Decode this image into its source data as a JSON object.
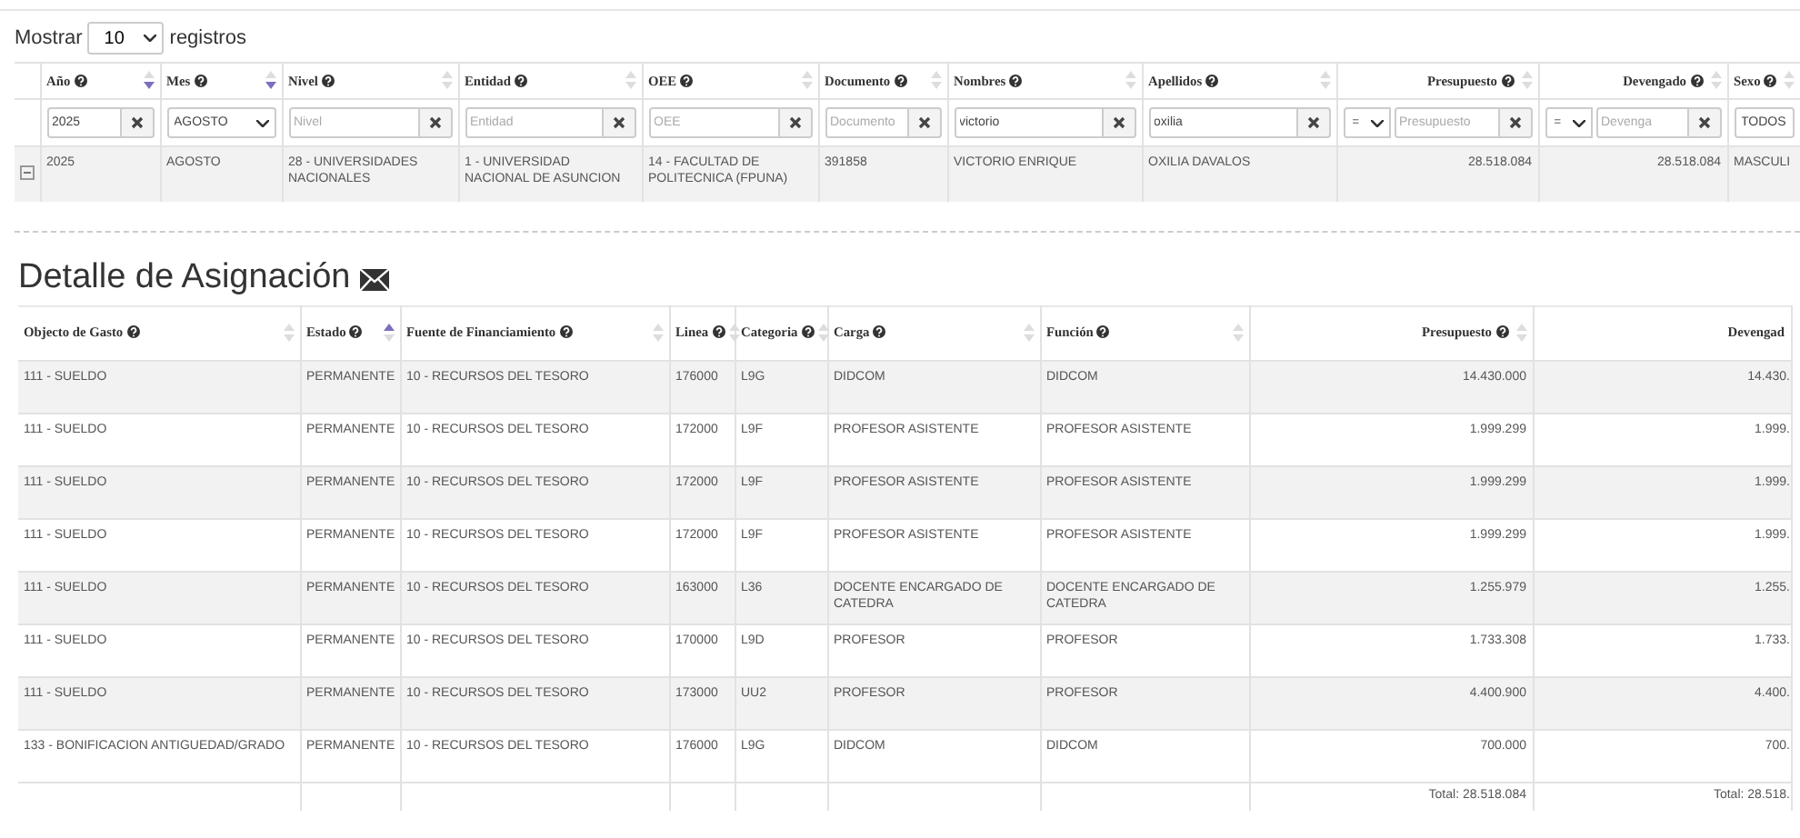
{
  "length_menu": {
    "prefix": "Mostrar",
    "value": "10",
    "suffix": "registros"
  },
  "top_table": {
    "columns": [
      {
        "label": "Año",
        "sorted": true,
        "ascending": false,
        "filter": {
          "kind": "text",
          "value": "2025"
        }
      },
      {
        "label": "Mes",
        "sorted": true,
        "ascending": false,
        "filter": {
          "kind": "select",
          "value": "AGOSTO"
        }
      },
      {
        "label": "Nivel",
        "sorted": false,
        "filter": {
          "kind": "text",
          "placeholder": "Nivel"
        }
      },
      {
        "label": "Entidad",
        "sorted": false,
        "filter": {
          "kind": "text",
          "placeholder": "Entidad"
        }
      },
      {
        "label": "OEE",
        "sorted": false,
        "filter": {
          "kind": "text",
          "placeholder": "OEE"
        }
      },
      {
        "label": "Documento",
        "sorted": false,
        "filter": {
          "kind": "text",
          "placeholder": "Documento"
        }
      },
      {
        "label": "Nombres",
        "sorted": false,
        "filter": {
          "kind": "text",
          "value": "victorio"
        }
      },
      {
        "label": "Apellidos",
        "sorted": false,
        "filter": {
          "kind": "text",
          "value": "oxilia"
        }
      },
      {
        "label": "Presupuesto",
        "sorted": false,
        "filter": {
          "kind": "compare",
          "operator": "=",
          "placeholder": "Presupuesto"
        }
      },
      {
        "label": "Devengado",
        "sorted": false,
        "filter": {
          "kind": "compare",
          "operator": "=",
          "placeholder": "Devenga"
        }
      },
      {
        "label": "Sexo",
        "sorted": false,
        "filter": {
          "kind": "select",
          "value": "TODOS"
        }
      }
    ],
    "rows": [
      {
        "expanded": true,
        "cells": [
          "2025",
          "AGOSTO",
          "28 - UNIVERSIDADES NACIONALES",
          "1 - UNIVERSIDAD NACIONAL DE ASUNCION",
          "14 - FACULTAD DE POLITECNICA (FPUNA)",
          "391858",
          "VICTORIO ENRIQUE",
          "OXILIA DAVALOS",
          "28.518.084",
          "28.518.084",
          "MASCULI"
        ]
      }
    ]
  },
  "detail": {
    "title": "Detalle de Asignación",
    "columns": [
      {
        "label": "Objecto de Gasto",
        "sorted": false
      },
      {
        "label": "Estado",
        "sorted": true,
        "ascending": true
      },
      {
        "label": "Fuente de Financiamiento",
        "sorted": false
      },
      {
        "label": "Linea",
        "sorted": false
      },
      {
        "label": "Categoria",
        "sorted": false
      },
      {
        "label": "Carga",
        "sorted": false
      },
      {
        "label": "Función",
        "sorted": false
      },
      {
        "label": "Presupuesto",
        "sorted": false
      },
      {
        "label": "Devengad"
      }
    ],
    "rows": [
      [
        "111 - SUELDO",
        "PERMANENTE",
        "10 - RECURSOS DEL TESORO",
        "176000",
        "L9G",
        "DIDCOM",
        "DIDCOM",
        "14.430.000",
        "14.430."
      ],
      [
        "111 - SUELDO",
        "PERMANENTE",
        "10 - RECURSOS DEL TESORO",
        "172000",
        "L9F",
        "PROFESOR ASISTENTE",
        "PROFESOR ASISTENTE",
        "1.999.299",
        "1.999."
      ],
      [
        "111 - SUELDO",
        "PERMANENTE",
        "10 - RECURSOS DEL TESORO",
        "172000",
        "L9F",
        "PROFESOR ASISTENTE",
        "PROFESOR ASISTENTE",
        "1.999.299",
        "1.999."
      ],
      [
        "111 - SUELDO",
        "PERMANENTE",
        "10 - RECURSOS DEL TESORO",
        "172000",
        "L9F",
        "PROFESOR ASISTENTE",
        "PROFESOR ASISTENTE",
        "1.999.299",
        "1.999."
      ],
      [
        "111 - SUELDO",
        "PERMANENTE",
        "10 - RECURSOS DEL TESORO",
        "163000",
        "L36",
        "DOCENTE ENCARGADO DE CATEDRA",
        "DOCENTE ENCARGADO DE CATEDRA",
        "1.255.979",
        "1.255."
      ],
      [
        "111 - SUELDO",
        "PERMANENTE",
        "10 - RECURSOS DEL TESORO",
        "170000",
        "L9D",
        "PROFESOR",
        "PROFESOR",
        "1.733.308",
        "1.733."
      ],
      [
        "111 - SUELDO",
        "PERMANENTE",
        "10 - RECURSOS DEL TESORO",
        "173000",
        "UU2",
        "PROFESOR",
        "PROFESOR",
        "4.400.900",
        "4.400."
      ],
      [
        "133 - BONIFICACION ANTIGUEDAD/GRADO",
        "PERMANENTE",
        "10 - RECURSOS DEL TESORO",
        "176000",
        "L9G",
        "DIDCOM",
        "DIDCOM",
        "700.000",
        "700."
      ]
    ],
    "totals": {
      "presupuesto": "Total: 28.518.084",
      "devengado": "Total: 28.518."
    }
  }
}
